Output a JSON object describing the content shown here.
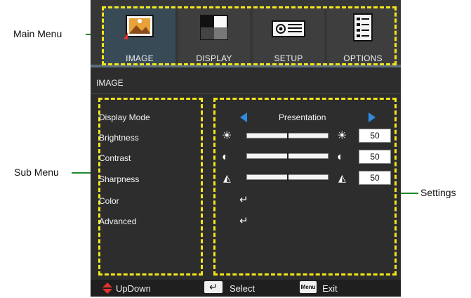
{
  "callouts": {
    "main_menu": "Main Menu",
    "sub_menu": "Sub Menu",
    "settings": "Settings"
  },
  "main_menu": {
    "tabs": [
      {
        "label": "IMAGE",
        "icon": "image-icon",
        "active": true
      },
      {
        "label": "DISPLAY",
        "icon": "display-icon",
        "active": false
      },
      {
        "label": "SETUP",
        "icon": "projector-icon",
        "active": false
      },
      {
        "label": "OPTIONS",
        "icon": "options-list-icon",
        "active": false
      }
    ]
  },
  "section_title": "IMAGE",
  "sub_menu": {
    "items": [
      "Display Mode",
      "Brightness",
      "Contrast",
      "Sharpness",
      "Color",
      "Advanced"
    ]
  },
  "settings": {
    "display_mode": "Presentation",
    "brightness": {
      "value": "50",
      "level": 0.5,
      "icon": "sun-icon"
    },
    "contrast": {
      "value": "50",
      "level": 0.5,
      "icon": "contrast-icon"
    },
    "sharpness": {
      "value": "50",
      "level": 0.5,
      "icon": "sharpness-icon"
    },
    "color_icon": "enter-icon",
    "advanced_icon": "enter-icon"
  },
  "bottom_bar": {
    "updown": "UpDown",
    "select": "Select",
    "menu_key": "Menu",
    "exit": "Exit"
  },
  "colors": {
    "highlight": "#f2e61a",
    "leader": "#36b24a",
    "arrow": "#2f8ae0",
    "updown_arrow": "#e0342a"
  }
}
